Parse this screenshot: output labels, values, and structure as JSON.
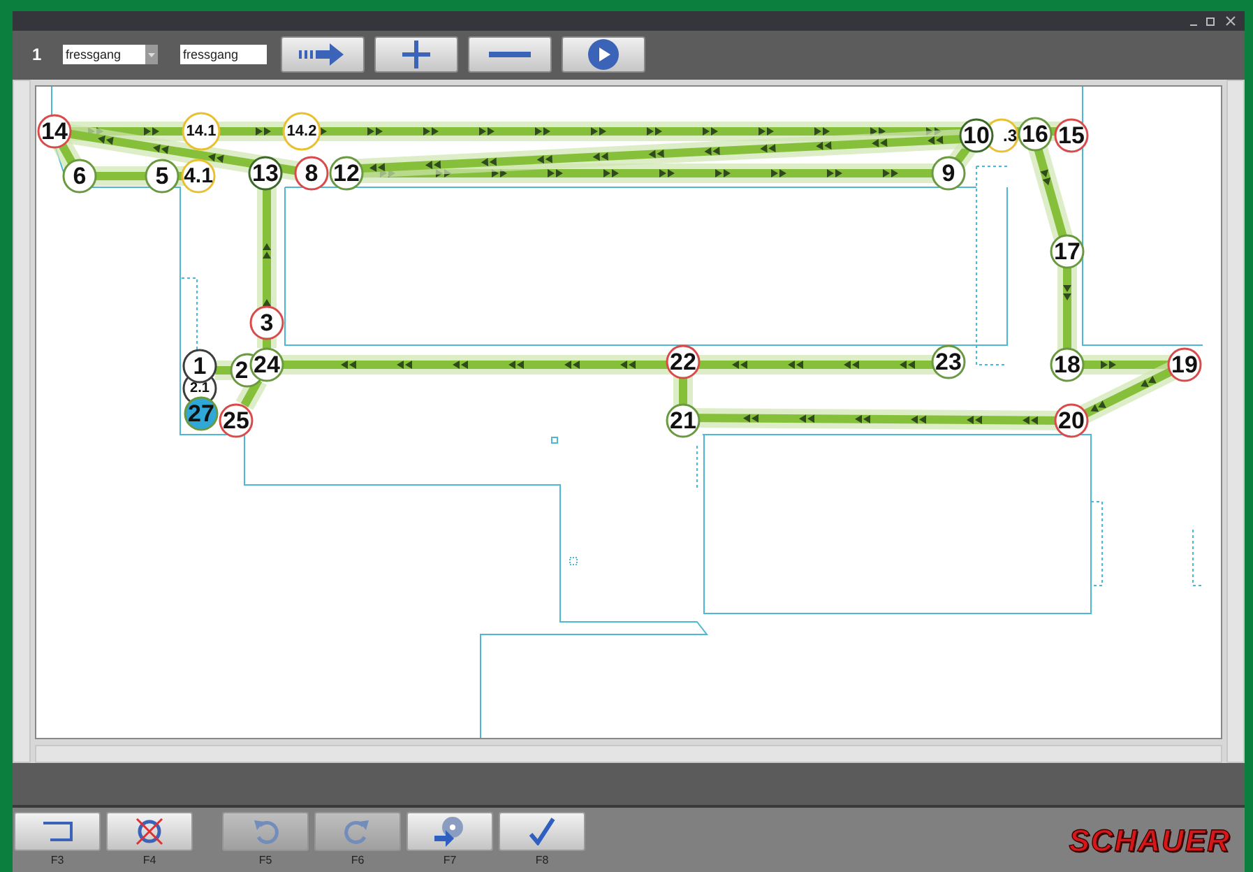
{
  "toolbar": {
    "row_number": "1",
    "route_select": {
      "value": "fressgang"
    },
    "name_field": {
      "value": "fressgang"
    },
    "buttons": [
      {
        "kind": "forward"
      },
      {
        "kind": "add"
      },
      {
        "kind": "remove"
      },
      {
        "kind": "play"
      }
    ]
  },
  "nodes": [
    {
      "label": "14",
      "color": "#d94a4a",
      "selected": false
    },
    {
      "label": "14.1",
      "color": "#e8c030",
      "selected": false
    },
    {
      "label": "14.2",
      "color": "#e8c030",
      "selected": false
    },
    {
      "label": "10",
      "color": "#3d6a2a",
      "selected": false
    },
    {
      "label": ".3",
      "color": "#e8c030",
      "selected": false
    },
    {
      "label": "16",
      "color": "#6a9a40",
      "selected": false
    },
    {
      "label": "15",
      "color": "#d94a4a",
      "selected": false
    },
    {
      "label": "6",
      "color": "#6a9a40",
      "selected": false
    },
    {
      "label": "5",
      "color": "#6a9a40",
      "selected": false
    },
    {
      "label": "4.1",
      "color": "#e8c030",
      "selected": false
    },
    {
      "label": "13",
      "color": "#3d6a2a",
      "selected": false
    },
    {
      "label": "8",
      "color": "#d94a4a",
      "selected": false
    },
    {
      "label": "12",
      "color": "#6a9a40",
      "selected": false
    },
    {
      "label": "9",
      "color": "#6a9a40",
      "selected": false
    },
    {
      "label": "17",
      "color": "#6a9a40",
      "selected": false
    },
    {
      "label": "3",
      "color": "#d94a4a",
      "selected": false
    },
    {
      "label": "1",
      "color": "#3d3d3d",
      "selected": false
    },
    {
      "label": "2.1",
      "color": "#3d3d3d",
      "selected": false
    },
    {
      "label": "2",
      "color": "#6a9a40",
      "selected": false
    },
    {
      "label": "24",
      "color": "#6a9a40",
      "selected": false
    },
    {
      "label": "22",
      "color": "#d94a4a",
      "selected": false
    },
    {
      "label": "23",
      "color": "#6a9a40",
      "selected": false
    },
    {
      "label": "18",
      "color": "#6a9a40",
      "selected": false
    },
    {
      "label": "19",
      "color": "#d94a4a",
      "selected": false
    },
    {
      "label": "27",
      "color": "#6a9a40",
      "selected": true
    },
    {
      "label": "25",
      "color": "#d94a4a",
      "selected": false
    },
    {
      "label": "21",
      "color": "#6a9a40",
      "selected": false
    },
    {
      "label": "20",
      "color": "#d94a4a",
      "selected": false
    }
  ],
  "function_keys": [
    {
      "key": "F3",
      "kind": "frame",
      "disabled": false
    },
    {
      "key": "F4",
      "kind": "delete",
      "disabled": false
    },
    {
      "key": "F5",
      "kind": "undo",
      "disabled": true
    },
    {
      "key": "F6",
      "kind": "redo",
      "disabled": true
    },
    {
      "key": "F7",
      "kind": "export",
      "disabled": false
    },
    {
      "key": "F8",
      "kind": "confirm",
      "disabled": false
    }
  ],
  "logo": "SCHAUER"
}
